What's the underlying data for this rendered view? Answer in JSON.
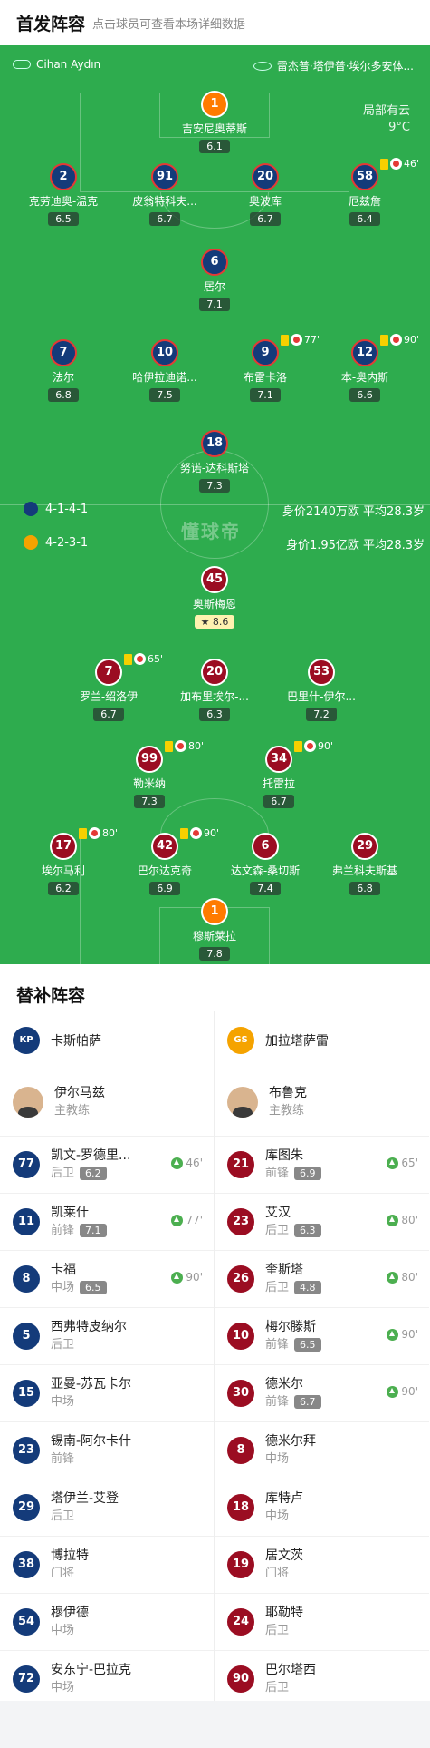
{
  "header": {
    "title": "首发阵容",
    "subtitle": "点击球员可查看本场详细数据"
  },
  "pitch": {
    "referee": "Cihan Aydın",
    "venue": "雷杰普·塔伊普·埃尔多安体...",
    "weather_1": "局部有云",
    "weather_2": "9°C",
    "watermark": "懂球帝",
    "home_formation": "4-1-4-1",
    "home_value": "身价2140万欧 平均28.3岁",
    "away_formation": "4-2-3-1",
    "away_value": "身价1.95亿欧 平均28.3岁"
  },
  "players": [
    {
      "num": "1",
      "name": "吉安尼奥蒂斯",
      "rating": "6.1",
      "side": "homegk"
    },
    {
      "num": "2",
      "name": "克劳迪奥-温克",
      "rating": "6.5",
      "side": "home"
    },
    {
      "num": "91",
      "name": "皮翁特科夫...",
      "rating": "6.7",
      "side": "home"
    },
    {
      "num": "20",
      "name": "奥波库",
      "rating": "6.7",
      "side": "home"
    },
    {
      "num": "58",
      "name": "厄兹詹",
      "rating": "6.4",
      "side": "home",
      "ev": "46'"
    },
    {
      "num": "6",
      "name": "居尔",
      "rating": "7.1",
      "side": "home"
    },
    {
      "num": "7",
      "name": "法尔",
      "rating": "6.8",
      "side": "home"
    },
    {
      "num": "10",
      "name": "哈伊拉迪诺...",
      "rating": "7.5",
      "side": "home"
    },
    {
      "num": "9",
      "name": "布雷卡洛",
      "rating": "7.1",
      "side": "home",
      "ev": "77'"
    },
    {
      "num": "12",
      "name": "本-奥内斯",
      "rating": "6.6",
      "side": "home",
      "ev": "90'"
    },
    {
      "num": "18",
      "name": "努诺-达科斯塔",
      "rating": "7.3",
      "side": "home"
    },
    {
      "num": "45",
      "name": "奥斯梅恩",
      "rating": "8.6",
      "side": "away"
    },
    {
      "num": "7",
      "name": "罗兰-绍洛伊",
      "rating": "6.7",
      "side": "away",
      "ev": "65'"
    },
    {
      "num": "20",
      "name": "加布里埃尔-...",
      "rating": "6.3",
      "side": "away"
    },
    {
      "num": "53",
      "name": "巴里什-伊尔...",
      "rating": "7.2",
      "side": "away"
    },
    {
      "num": "99",
      "name": "勒米纳",
      "rating": "7.3",
      "side": "away",
      "ev": "80'"
    },
    {
      "num": "34",
      "name": "托雷拉",
      "rating": "6.7",
      "side": "away",
      "ev": "90'"
    },
    {
      "num": "17",
      "name": "埃尔马利",
      "rating": "6.2",
      "side": "away",
      "ev": "80'"
    },
    {
      "num": "42",
      "name": "巴尔达克奇",
      "rating": "6.9",
      "side": "away",
      "ev": "90'"
    },
    {
      "num": "6",
      "name": "达文森-桑切斯",
      "rating": "7.4",
      "side": "away"
    },
    {
      "num": "29",
      "name": "弗兰科夫斯基",
      "rating": "6.8",
      "side": "away"
    },
    {
      "num": "1",
      "name": "穆斯莱拉",
      "rating": "7.8",
      "side": "awaygk"
    }
  ],
  "subs": {
    "title": "替补阵容",
    "home": {
      "team": "卡斯帕萨",
      "coach": "伊尔马兹",
      "coach_role": "主教练",
      "list": [
        {
          "num": "77",
          "name": "凯文-罗德里...",
          "pos": "后卫",
          "rating": "6.2",
          "ev": "46'"
        },
        {
          "num": "11",
          "name": "凯莱什",
          "pos": "前锋",
          "rating": "7.1",
          "ev": "77'"
        },
        {
          "num": "8",
          "name": "卡福",
          "pos": "中场",
          "rating": "6.5",
          "ev": "90'"
        },
        {
          "num": "5",
          "name": "西弗特皮纳尔",
          "pos": "后卫"
        },
        {
          "num": "15",
          "name": "亚曼-苏瓦卡尔",
          "pos": "中场"
        },
        {
          "num": "23",
          "name": "锡南-阿尔卡什",
          "pos": "前锋"
        },
        {
          "num": "29",
          "name": "塔伊兰-艾登",
          "pos": "后卫"
        },
        {
          "num": "38",
          "name": "博拉特",
          "pos": "门将"
        },
        {
          "num": "54",
          "name": "穆伊德",
          "pos": "中场"
        },
        {
          "num": "72",
          "name": "安东宁-巴拉克",
          "pos": "中场"
        }
      ]
    },
    "away": {
      "team": "加拉塔萨雷",
      "coach": "布鲁克",
      "coach_role": "主教练",
      "list": [
        {
          "num": "21",
          "name": "库图朱",
          "pos": "前锋",
          "rating": "6.9",
          "ev": "65'"
        },
        {
          "num": "23",
          "name": "艾汉",
          "pos": "后卫",
          "rating": "6.3",
          "ev": "80'"
        },
        {
          "num": "26",
          "name": "奎斯塔",
          "pos": "后卫",
          "rating": "4.8",
          "ev": "80'"
        },
        {
          "num": "10",
          "name": "梅尔滕斯",
          "pos": "前锋",
          "rating": "6.5",
          "ev": "90'"
        },
        {
          "num": "30",
          "name": "德米尔",
          "pos": "前锋",
          "rating": "6.7",
          "ev": "90'"
        },
        {
          "num": "8",
          "name": "德米尔拜",
          "pos": "中场"
        },
        {
          "num": "18",
          "name": "库特卢",
          "pos": "中场"
        },
        {
          "num": "19",
          "name": "居文茨",
          "pos": "门将"
        },
        {
          "num": "24",
          "name": "耶勒特",
          "pos": "后卫"
        },
        {
          "num": "90",
          "name": "巴尔塔西",
          "pos": "后卫"
        }
      ]
    }
  }
}
